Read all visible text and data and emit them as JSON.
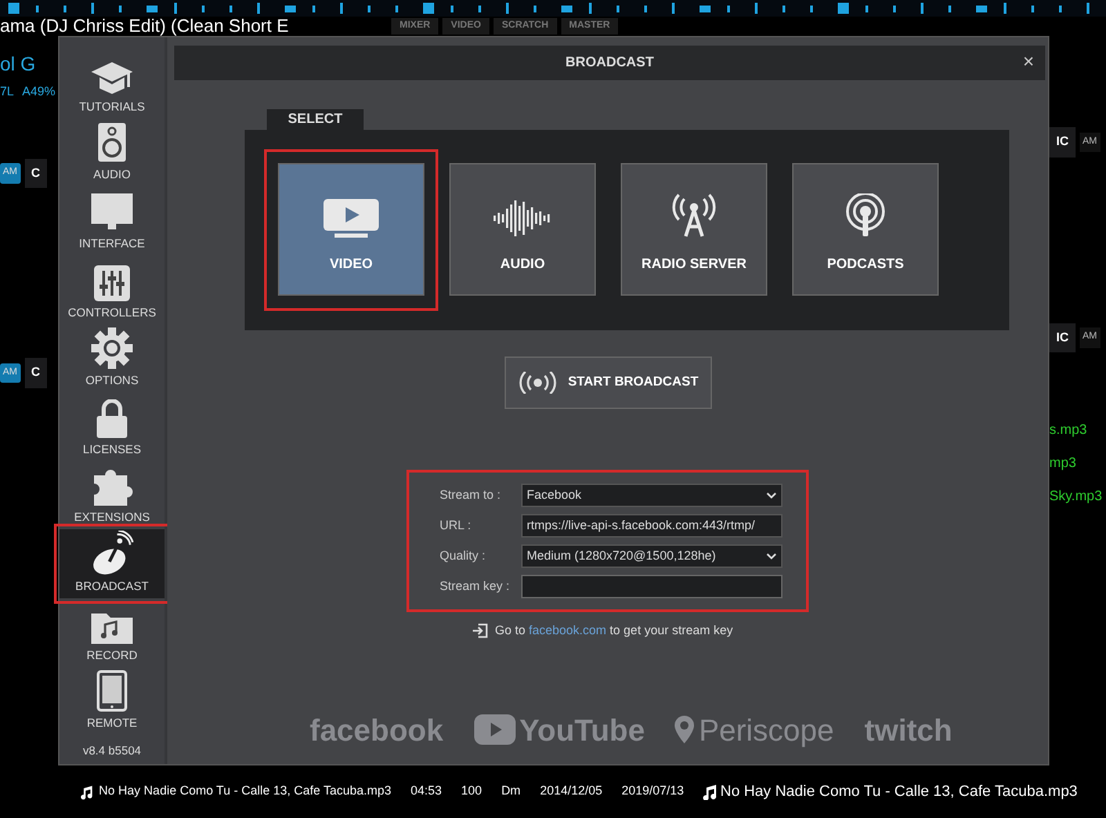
{
  "background": {
    "deck_title": "ama (DJ Chriss Edit) (Clean Short E",
    "deck_artist": "ol G",
    "deck_info": [
      "7L",
      "A49%"
    ],
    "view_tabs": [
      "MIXER",
      "VIDEO",
      "SCRATCH",
      "MASTER"
    ],
    "left_buttons": [
      [
        "AM",
        "C"
      ],
      [
        "AM",
        "C"
      ]
    ],
    "right_buttons": [
      [
        "IC",
        "AM"
      ],
      [
        "IC",
        "AM"
      ]
    ],
    "right_files": [
      "s.mp3",
      "mp3",
      "Sky.mp3"
    ],
    "track_row": {
      "title": "No Hay Nadie Como Tu - Calle 13, Cafe Tacuba.mp3",
      "time": "04:53",
      "bpm": "100",
      "key": "Dm",
      "added": "2014/12/05",
      "played": "2019/07/13"
    },
    "right_track": "No Hay Nadie Como Tu - Calle 13, Cafe Tacuba.mp3"
  },
  "window": {
    "title": "BROADCAST",
    "close": "×"
  },
  "sidebar": {
    "items": [
      {
        "kind": "tutorials",
        "label": "TUTORIALS",
        "selected": false,
        "highlighted": false
      },
      {
        "kind": "audio",
        "label": "AUDIO",
        "selected": false,
        "highlighted": false
      },
      {
        "kind": "interface",
        "label": "INTERFACE",
        "selected": false,
        "highlighted": false
      },
      {
        "kind": "controllers",
        "label": "CONTROLLERS",
        "selected": false,
        "highlighted": false
      },
      {
        "kind": "options",
        "label": "OPTIONS",
        "selected": false,
        "highlighted": false
      },
      {
        "kind": "licenses",
        "label": "LICENSES",
        "selected": false,
        "highlighted": false
      },
      {
        "kind": "extensions",
        "label": "EXTENSIONS",
        "selected": false,
        "highlighted": false
      },
      {
        "kind": "broadcast",
        "label": "BROADCAST",
        "selected": true,
        "highlighted": true
      },
      {
        "kind": "record",
        "label": "RECORD",
        "selected": false,
        "highlighted": false
      },
      {
        "kind": "remote",
        "label": "REMOTE",
        "selected": false,
        "highlighted": false
      }
    ],
    "version": "v8.4 b5504"
  },
  "select": {
    "label": "SELECT",
    "options": [
      {
        "kind": "video",
        "label": "VIDEO",
        "selected": true,
        "highlighted": true
      },
      {
        "kind": "audio",
        "label": "AUDIO",
        "selected": false,
        "highlighted": false
      },
      {
        "kind": "radio",
        "label": "RADIO SERVER",
        "selected": false,
        "highlighted": false
      },
      {
        "kind": "podcast",
        "label": "PODCASTS",
        "selected": false,
        "highlighted": false
      }
    ]
  },
  "start_button": "START BROADCAST",
  "form": {
    "highlighted": true,
    "fields": [
      {
        "kind": "select",
        "label": "Stream to :",
        "value": "Facebook"
      },
      {
        "kind": "text",
        "label": "URL :",
        "value": "rtmps://live-api-s.facebook.com:443/rtmp/"
      },
      {
        "kind": "select",
        "label": "Quality :",
        "value": "Medium (1280x720@1500,128he)"
      },
      {
        "kind": "text",
        "label": "Stream key :"
      }
    ]
  },
  "help": {
    "before": "Go to",
    "link": "facebook.com",
    "after": "to get your stream key"
  },
  "platforms": [
    "facebook",
    "YouTube",
    "Periscope",
    "twitch"
  ]
}
